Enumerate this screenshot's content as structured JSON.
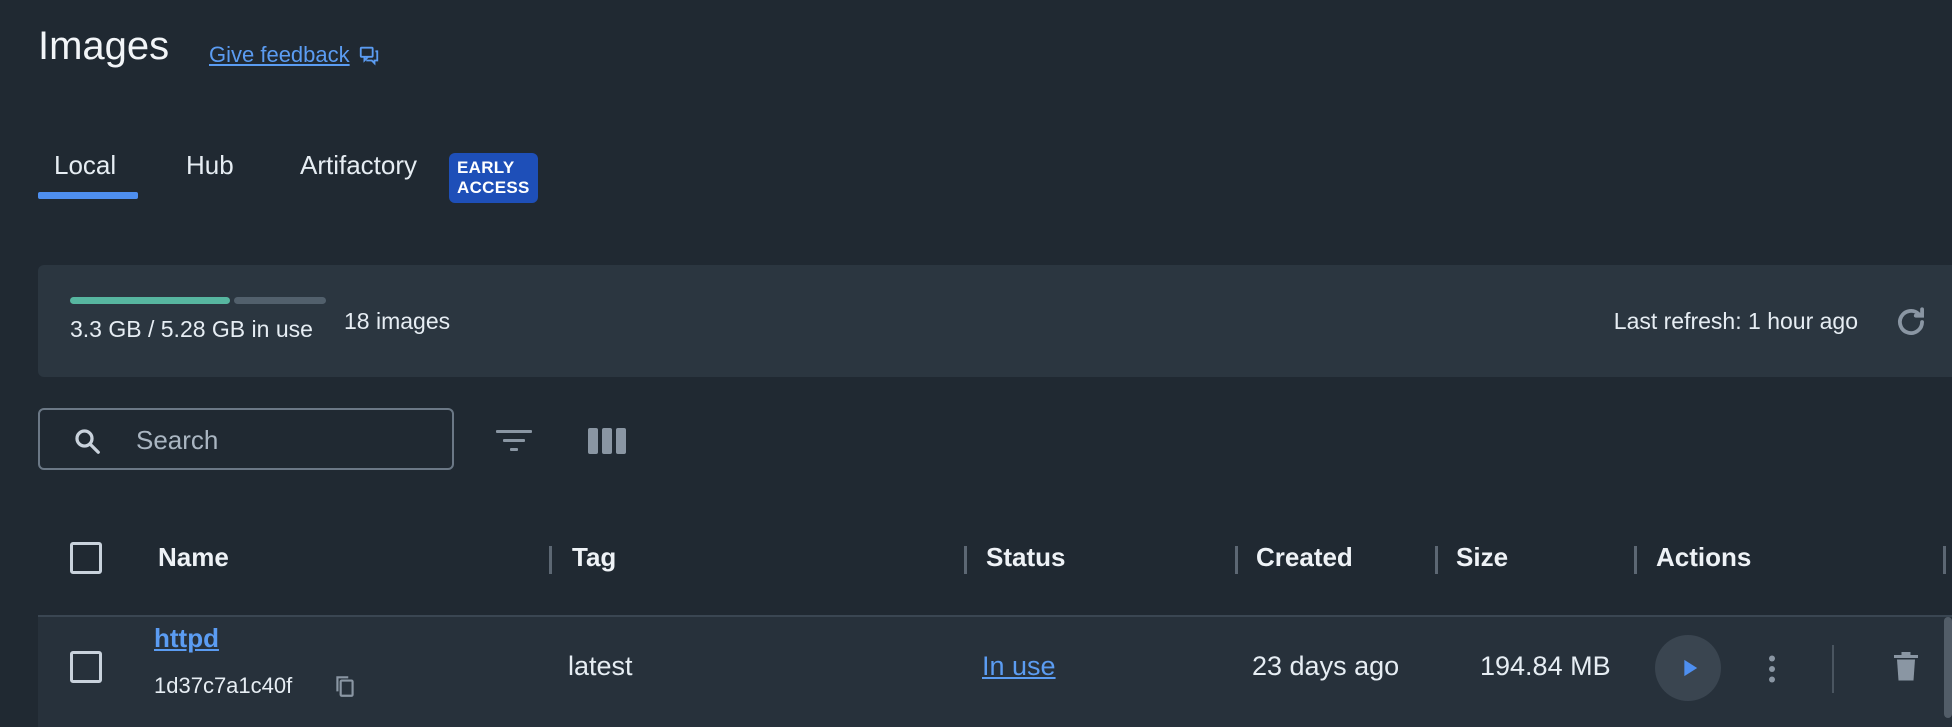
{
  "page": {
    "title": "Images",
    "feedback_label": "Give feedback"
  },
  "tabs": [
    {
      "label": "Local",
      "active": true
    },
    {
      "label": "Hub",
      "active": false
    },
    {
      "label": "Artifactory",
      "active": false,
      "badge": "EARLY ACCESS"
    }
  ],
  "stats": {
    "usage_text": "3.3 GB / 5.28 GB in use",
    "used_fraction": 0.625,
    "image_count": "18 images",
    "last_refresh": "Last refresh: 1 hour ago"
  },
  "toolbar": {
    "search_placeholder": "Search",
    "icons": [
      "search-icon",
      "filter-icon",
      "columns-icon"
    ]
  },
  "table": {
    "columns": [
      "Name",
      "Tag",
      "Status",
      "Created",
      "Size",
      "Actions"
    ],
    "rows": [
      {
        "name": "httpd",
        "id": "1d37c7a1c40f",
        "tag": "latest",
        "status": "In use",
        "created": "23 days ago",
        "size": "194.84 MB"
      }
    ]
  },
  "colors": {
    "background": "#202932",
    "panel": "#2b3640",
    "accent": "#4e8ff0",
    "link": "#5b9cf2",
    "badge": "#1e4fb8",
    "usage_bar": "#57b6a0"
  }
}
